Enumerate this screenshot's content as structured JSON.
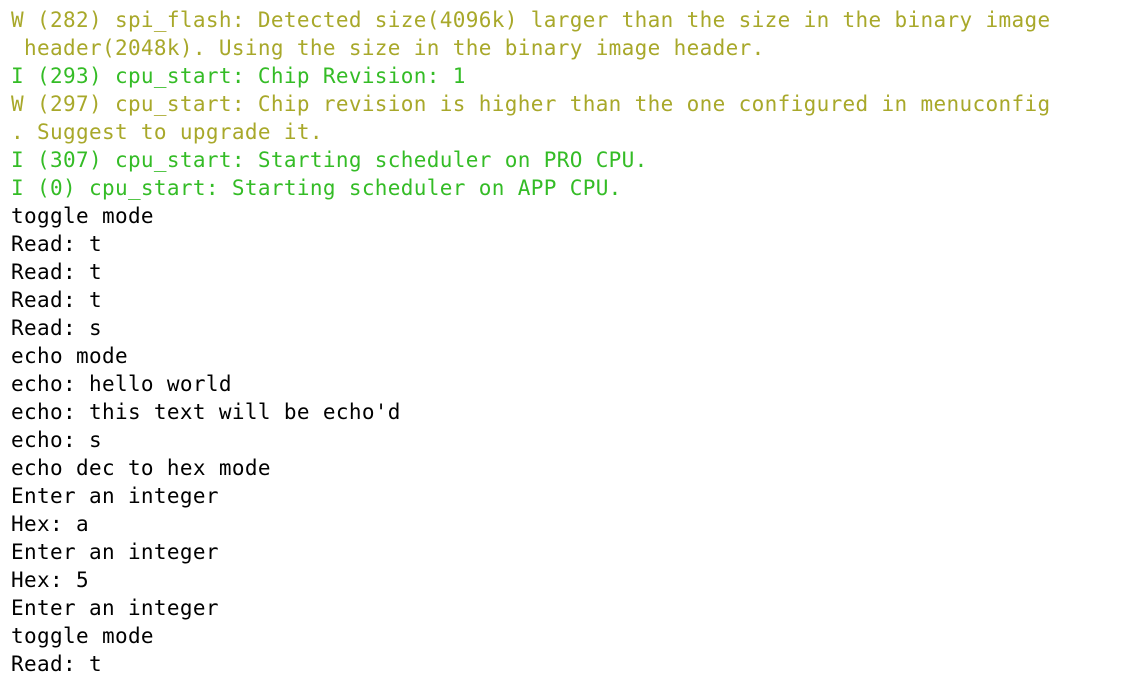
{
  "colors": {
    "warning": "#a8a82a",
    "info": "#34bc26",
    "plain": "#000000",
    "background": "#ffffff"
  },
  "lines": [
    {
      "level": "W",
      "text": "W (282) spi_flash: Detected size(4096k) larger than the size in the binary image"
    },
    {
      "level": "W",
      "text": " header(2048k). Using the size in the binary image header."
    },
    {
      "level": "I",
      "text": "I (293) cpu_start: Chip Revision: 1"
    },
    {
      "level": "W",
      "text": "W (297) cpu_start: Chip revision is higher than the one configured in menuconfig"
    },
    {
      "level": "W",
      "text": ". Suggest to upgrade it."
    },
    {
      "level": "I",
      "text": "I (307) cpu_start: Starting scheduler on PRO CPU."
    },
    {
      "level": "I",
      "text": "I (0) cpu_start: Starting scheduler on APP CPU."
    },
    {
      "level": "plain",
      "text": "toggle mode"
    },
    {
      "level": "plain",
      "text": "Read: t"
    },
    {
      "level": "plain",
      "text": "Read: t"
    },
    {
      "level": "plain",
      "text": "Read: t"
    },
    {
      "level": "plain",
      "text": "Read: s"
    },
    {
      "level": "plain",
      "text": "echo mode"
    },
    {
      "level": "plain",
      "text": "echo: hello world"
    },
    {
      "level": "plain",
      "text": "echo: this text will be echo'd"
    },
    {
      "level": "plain",
      "text": "echo: s"
    },
    {
      "level": "plain",
      "text": "echo dec to hex mode"
    },
    {
      "level": "plain",
      "text": "Enter an integer"
    },
    {
      "level": "plain",
      "text": "Hex: a"
    },
    {
      "level": "plain",
      "text": "Enter an integer"
    },
    {
      "level": "plain",
      "text": "Hex: 5"
    },
    {
      "level": "plain",
      "text": "Enter an integer"
    },
    {
      "level": "plain",
      "text": "toggle mode"
    },
    {
      "level": "plain",
      "text": "Read: t"
    }
  ]
}
